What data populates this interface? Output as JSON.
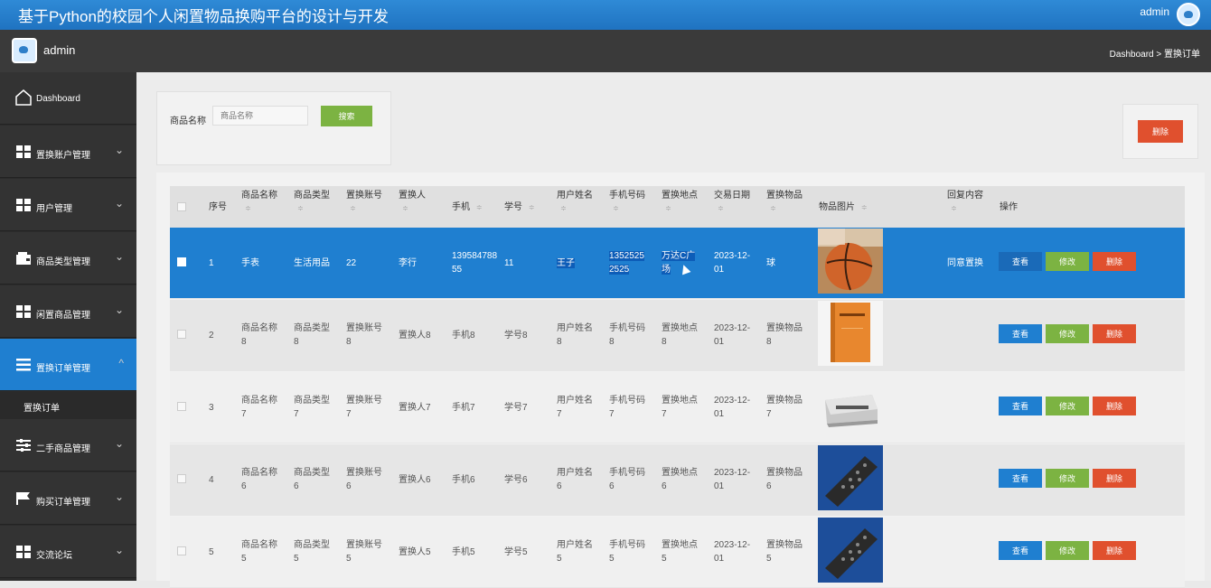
{
  "header": {
    "title": "基于Python的校园个人闲置物品换购平台的设计与开发",
    "user": "admin"
  },
  "subheader": {
    "name": "admin",
    "breadcrumb": "Dashboard > 置换订单"
  },
  "sidebar": {
    "items": [
      {
        "label": "Dashboard"
      },
      {
        "label": "置换账户管理"
      },
      {
        "label": "用户管理"
      },
      {
        "label": "商品类型管理"
      },
      {
        "label": "闲置商品管理"
      },
      {
        "label": "置换订单管理"
      },
      {
        "label": "二手商品管理"
      },
      {
        "label": "购买订单管理"
      },
      {
        "label": "交流论坛"
      }
    ],
    "subitem": "置换订单"
  },
  "search": {
    "label": "商品名称",
    "placeholder": "商品名称",
    "button": "搜索"
  },
  "toolbar": {
    "delete": "删除"
  },
  "table": {
    "headers": [
      "序号",
      "商品名称",
      "商品类型",
      "置换账号",
      "置换人",
      "手机",
      "学号",
      "用户姓名",
      "手机号码",
      "置换地点",
      "交易日期",
      "置换物品",
      "物品图片",
      "回复内容",
      "操作"
    ],
    "sort_glyph": "≑",
    "actions": {
      "view": "查看",
      "edit": "修改",
      "delete": "删除"
    },
    "rows": [
      {
        "no": "1",
        "name": "手表",
        "type": "生活用品",
        "account": "22",
        "person": "李行",
        "phone": "13958478855",
        "sid": "11",
        "uname": "王子",
        "mobile": "13525252525",
        "place": "万达C广场",
        "date": "2023-12-01",
        "item": "球",
        "reply": "同意置换"
      },
      {
        "no": "2",
        "name": "商品名称8",
        "type": "商品类型8",
        "account": "置换账号8",
        "person": "置换人8",
        "phone": "手机8",
        "sid": "学号8",
        "uname": "用户姓名8",
        "mobile": "手机号码8",
        "place": "置换地点8",
        "date": "2023-12-01",
        "item": "置换物品8",
        "reply": ""
      },
      {
        "no": "3",
        "name": "商品名称7",
        "type": "商品类型7",
        "account": "置换账号7",
        "person": "置换人7",
        "phone": "手机7",
        "sid": "学号7",
        "uname": "用户姓名7",
        "mobile": "手机号码7",
        "place": "置换地点7",
        "date": "2023-12-01",
        "item": "置换物品7",
        "reply": ""
      },
      {
        "no": "4",
        "name": "商品名称6",
        "type": "商品类型6",
        "account": "置换账号6",
        "person": "置换人6",
        "phone": "手机6",
        "sid": "学号6",
        "uname": "用户姓名6",
        "mobile": "手机号码6",
        "place": "置换地点6",
        "date": "2023-12-01",
        "item": "置换物品6",
        "reply": ""
      },
      {
        "no": "5",
        "name": "商品名称5",
        "type": "商品类型5",
        "account": "置换账号5",
        "person": "置换人5",
        "phone": "手机5",
        "sid": "学号5",
        "uname": "用户姓名5",
        "mobile": "手机号码5",
        "place": "置换地点5",
        "date": "2023-12-01",
        "item": "置换物品5",
        "reply": ""
      }
    ]
  },
  "colors": {
    "primary": "#1f7fd0",
    "success": "#7cb342",
    "danger": "#e0502e"
  }
}
